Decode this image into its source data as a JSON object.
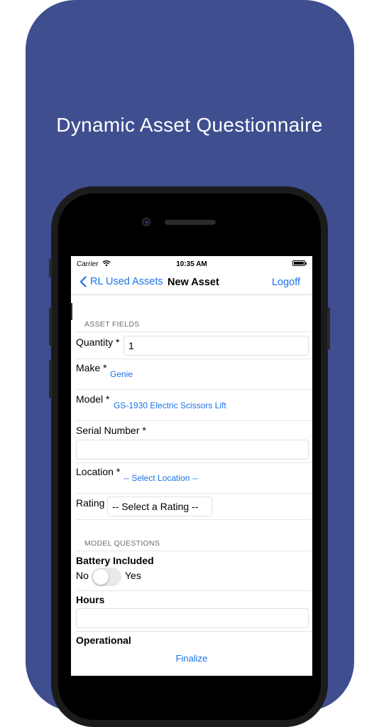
{
  "marketing": {
    "headline": "Dynamic Asset Questionnaire"
  },
  "status_bar": {
    "carrier": "Carrier",
    "time": "10:35 AM"
  },
  "nav": {
    "back_label": "RL Used Assets",
    "title": "New Asset",
    "logoff_label": "Logoff"
  },
  "asset_fields": {
    "header": "ASSET FIELDS",
    "quantity": {
      "label": "Quantity *",
      "value": "1"
    },
    "make": {
      "label": "Make *",
      "value": "Genie"
    },
    "model": {
      "label": "Model *",
      "value": "GS-1930 Electric Scissors Lift"
    },
    "serial": {
      "label": "Serial Number *",
      "value": ""
    },
    "location": {
      "label": "Location *",
      "value": "-- Select Location --"
    },
    "rating": {
      "label": "Rating",
      "value": "-- Select a Rating --"
    }
  },
  "model_questions": {
    "header": "MODEL QUESTIONS",
    "battery": {
      "label": "Battery Included",
      "off_label": "No",
      "on_label": "Yes",
      "checked": false
    },
    "hours": {
      "label": "Hours",
      "value": ""
    },
    "operational": {
      "label": "Operational"
    }
  },
  "footer": {
    "finalize_label": "Finalize"
  },
  "colors": {
    "brand_bg": "#3f4e8f",
    "link": "#1a73e8"
  }
}
